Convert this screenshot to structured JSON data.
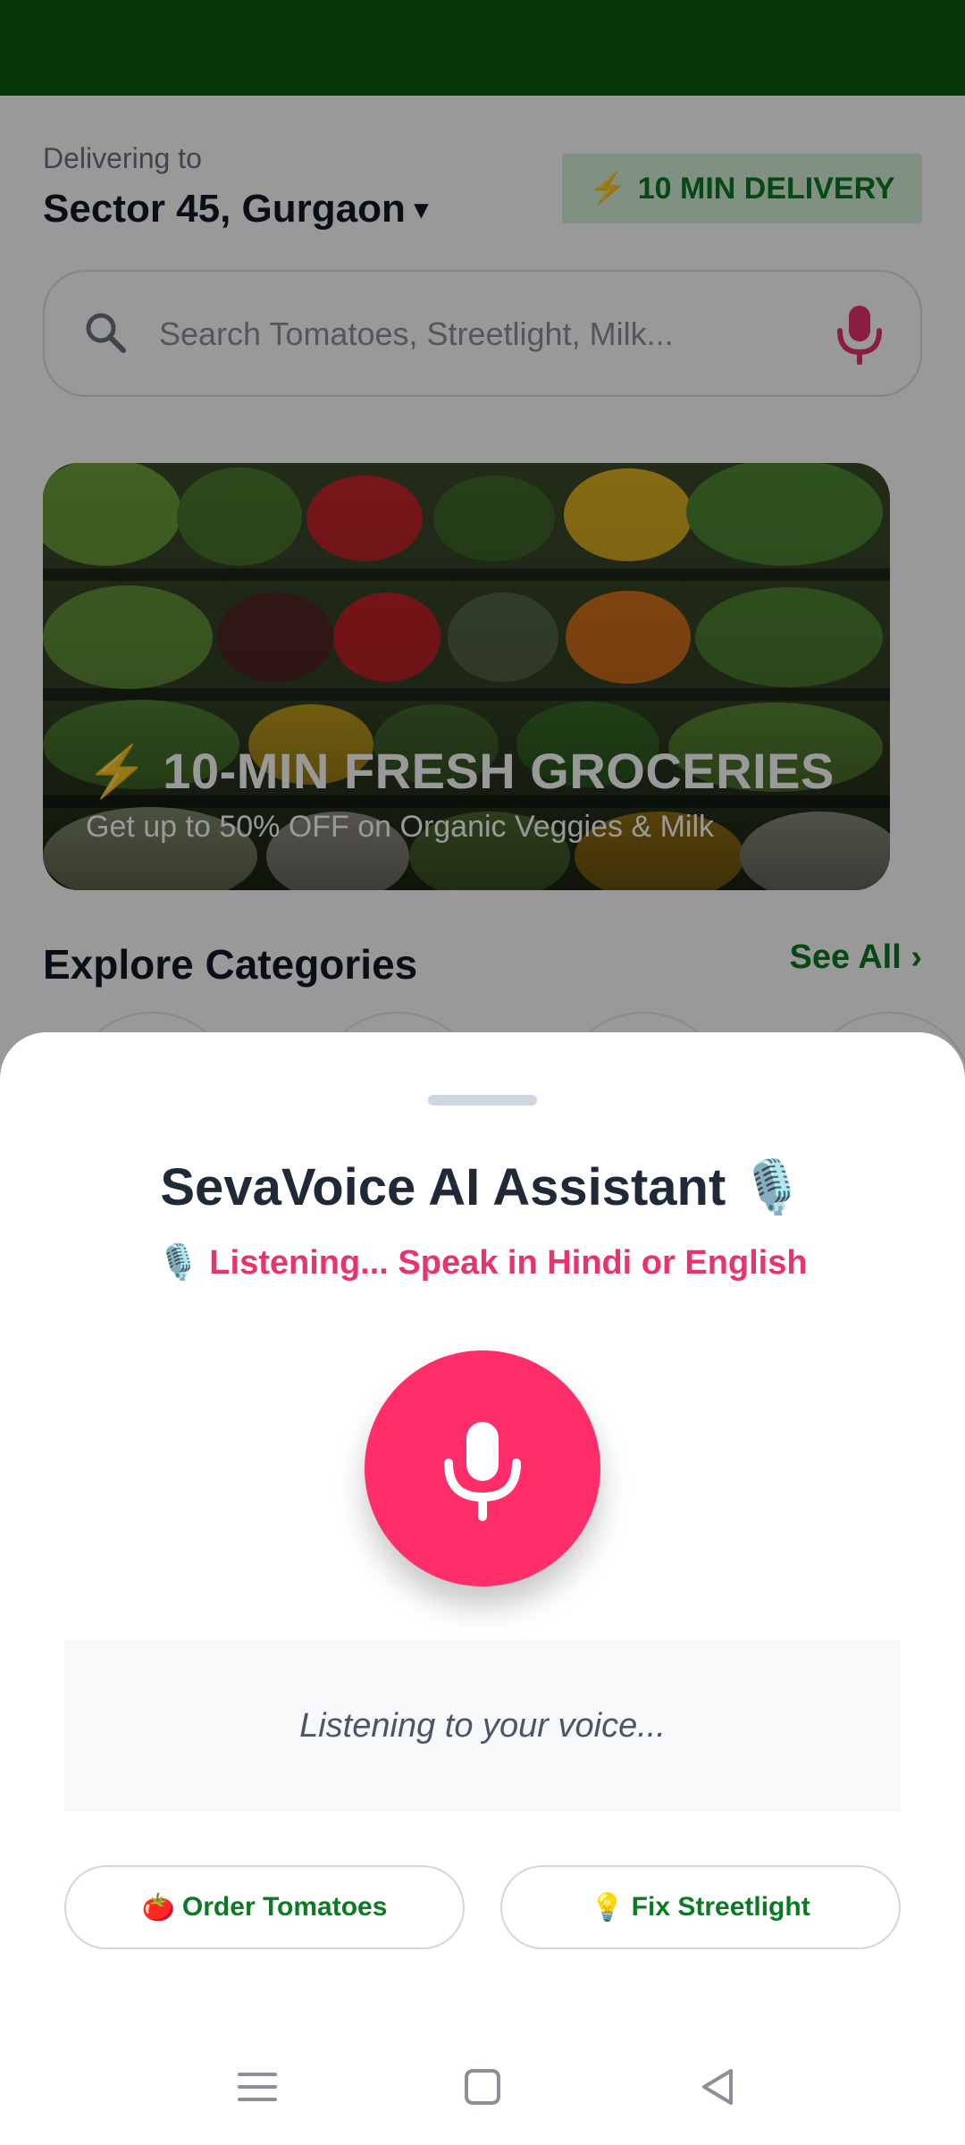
{
  "header": {
    "delivering_caption": "Delivering to",
    "location": "Sector 45, Gurgaon",
    "location_caret": "▾",
    "badge_icon": "⚡",
    "badge_text": "10 MIN DELIVERY"
  },
  "search": {
    "placeholder": "Search Tomatoes, Streetlight, Milk..."
  },
  "banner": {
    "icon": "⚡",
    "title": "10-MIN FRESH GROCERIES",
    "subtitle": "Get up to 50% OFF on Organic Veggies & Milk"
  },
  "categories": {
    "title": "Explore Categories",
    "see_all": "See All ›"
  },
  "voice_sheet": {
    "title": "SevaVoice AI Assistant",
    "title_icon": "🎙️",
    "status_icon": "🎙️",
    "status": "Listening... Speak in Hindi or English",
    "transcript": "Listening to your voice...",
    "suggestions": [
      {
        "icon": "🍅",
        "label": "Order Tomatoes"
      },
      {
        "icon": "💡",
        "label": "Fix Streetlight"
      }
    ]
  },
  "colors": {
    "status_bar": "#0b5e14",
    "brand_green": "#0b7a22",
    "mic_pink": "#ff2e6a",
    "status_pink": "#e8336b"
  }
}
